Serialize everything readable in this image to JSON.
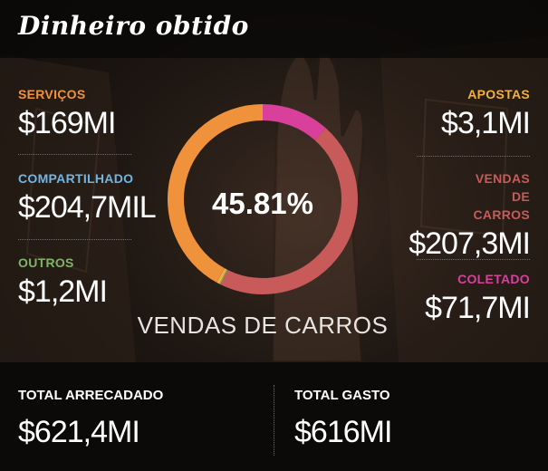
{
  "title": "Dinheiro obtido",
  "left_stats": [
    {
      "label": "SERVIÇOS",
      "value": "$169MI",
      "color": "#f0923c"
    },
    {
      "label": "COMPARTILHADO",
      "value": "$204,7MIL",
      "color": "#6fb6e4"
    },
    {
      "label": "OUTROS",
      "value": "$1,2MI",
      "color": "#7fb36a"
    }
  ],
  "right_stats": [
    {
      "label": "APOSTAS",
      "value": "$3,1MI",
      "color": "#f2b13b"
    },
    {
      "label": "VENDAS DE CARROS",
      "value": "$207,3MI",
      "color": "#c85a5a"
    },
    {
      "label": "COLETADO",
      "value": "$71,7MI",
      "color": "#d8409c"
    }
  ],
  "donut": {
    "percent_label": "45.81%",
    "segment_label": "VENDAS DE CARROS",
    "slices": [
      {
        "name": "COLETADO",
        "fraction": 0.1154,
        "color": "#d8409c"
      },
      {
        "name": "VENDAS DE CARROS",
        "fraction": 0.4581,
        "color": "#c85a5a"
      },
      {
        "name": "OUTROS",
        "fraction": 0.0019,
        "color": "#7fb36a"
      },
      {
        "name": "APOSTAS",
        "fraction": 0.005,
        "color": "#f2b13b"
      },
      {
        "name": "COMPARTILHADO",
        "fraction": 0.0003,
        "color": "#6fb6e4"
      },
      {
        "name": "SERVIÇOS",
        "fraction": 0.4193,
        "color": "#f0923c"
      }
    ]
  },
  "footer": {
    "total_collected_label": "TOTAL ARRECADADO",
    "total_collected_value": "$621,4MI",
    "total_spent_label": "TOTAL GASTO",
    "total_spent_value": "$616MI"
  }
}
